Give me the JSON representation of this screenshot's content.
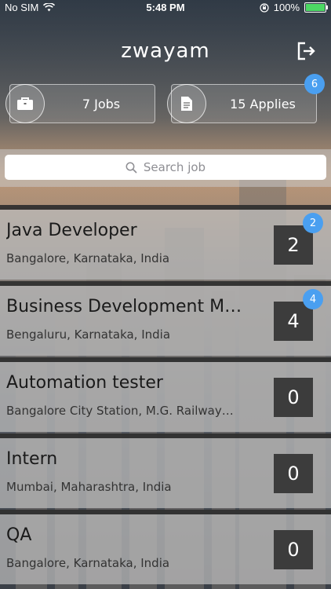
{
  "status_bar": {
    "carrier": "No SIM",
    "time": "5:48 PM",
    "battery": "100%"
  },
  "header": {
    "logo": "zwayam"
  },
  "stats": {
    "jobs_label": "7 Jobs",
    "applies_label": "15 Applies",
    "applies_badge": "6"
  },
  "search": {
    "placeholder": "Search job"
  },
  "jobs": [
    {
      "title": "Java Developer",
      "location": "Bangalore, Karnataka, India",
      "count": "2",
      "badge": "2"
    },
    {
      "title": "Business Development M…",
      "location": "Bengaluru, Karnataka, India",
      "count": "4",
      "badge": "4"
    },
    {
      "title": "Automation tester",
      "location": "Bangalore City Station, M.G. Railway…",
      "count": "0"
    },
    {
      "title": "Intern",
      "location": "Mumbai, Maharashtra, India",
      "count": "0"
    },
    {
      "title": "QA",
      "location": "Bangalore, Karnataka, India",
      "count": "0"
    }
  ],
  "colors": {
    "badge": "#4a9ff0",
    "count_box": "#3c3c3c",
    "battery": "#4cd964"
  },
  "icons": [
    "wifi-icon",
    "rotation-lock-icon",
    "battery-icon",
    "logout-icon",
    "briefcase-icon",
    "document-icon",
    "search-icon"
  ]
}
